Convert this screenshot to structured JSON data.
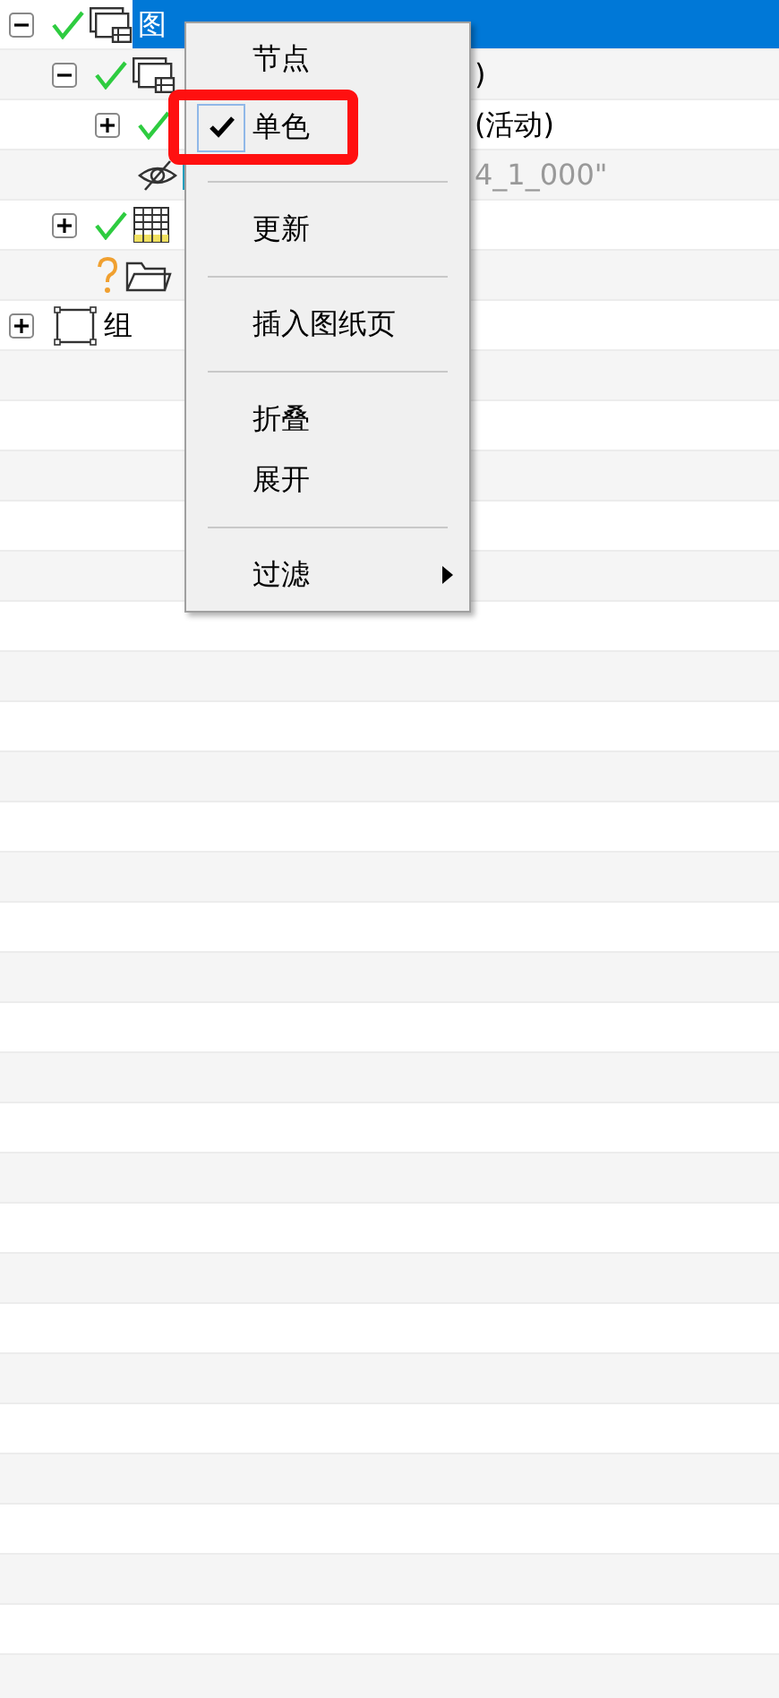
{
  "tree": [
    {
      "label": "图",
      "selected": true,
      "expanded": true,
      "visible": true,
      "kind": "sheet",
      "children": [
        {
          "label": ")",
          "selected": false,
          "expanded": true,
          "visible": true,
          "kind": "sheet",
          "children": [
            {
              "label": "(活动)",
              "selected": false,
              "expanded": false,
              "visible": true,
              "kind": "sheet_entry"
            },
            {
              "label": "4_1_000\"",
              "selected": false,
              "visible": false,
              "kind": "view"
            }
          ]
        },
        {
          "selected": false,
          "expanded": false,
          "visible": true,
          "kind": "table"
        },
        {
          "selected": false,
          "unresolved": true,
          "kind": "folder"
        }
      ]
    },
    {
      "label": "组",
      "selected": false,
      "expanded": false,
      "kind": "group"
    }
  ],
  "context_menu": {
    "items": [
      {
        "kind": "item",
        "label": "节点",
        "checked": false,
        "highlighted": false
      },
      {
        "kind": "item",
        "label": "单色",
        "checked": true,
        "highlighted": true
      },
      {
        "kind": "separator"
      },
      {
        "kind": "item",
        "label": "更新",
        "checked": false,
        "highlighted": false
      },
      {
        "kind": "separator"
      },
      {
        "kind": "item",
        "label": "插入图纸页",
        "checked": false,
        "highlighted": false
      },
      {
        "kind": "separator"
      },
      {
        "kind": "item",
        "label": "折叠",
        "checked": false,
        "highlighted": false
      },
      {
        "kind": "item",
        "label": "展开",
        "checked": false,
        "highlighted": false
      },
      {
        "kind": "separator"
      },
      {
        "kind": "submenu",
        "label": "过滤",
        "checked": false,
        "highlighted": false
      }
    ]
  }
}
